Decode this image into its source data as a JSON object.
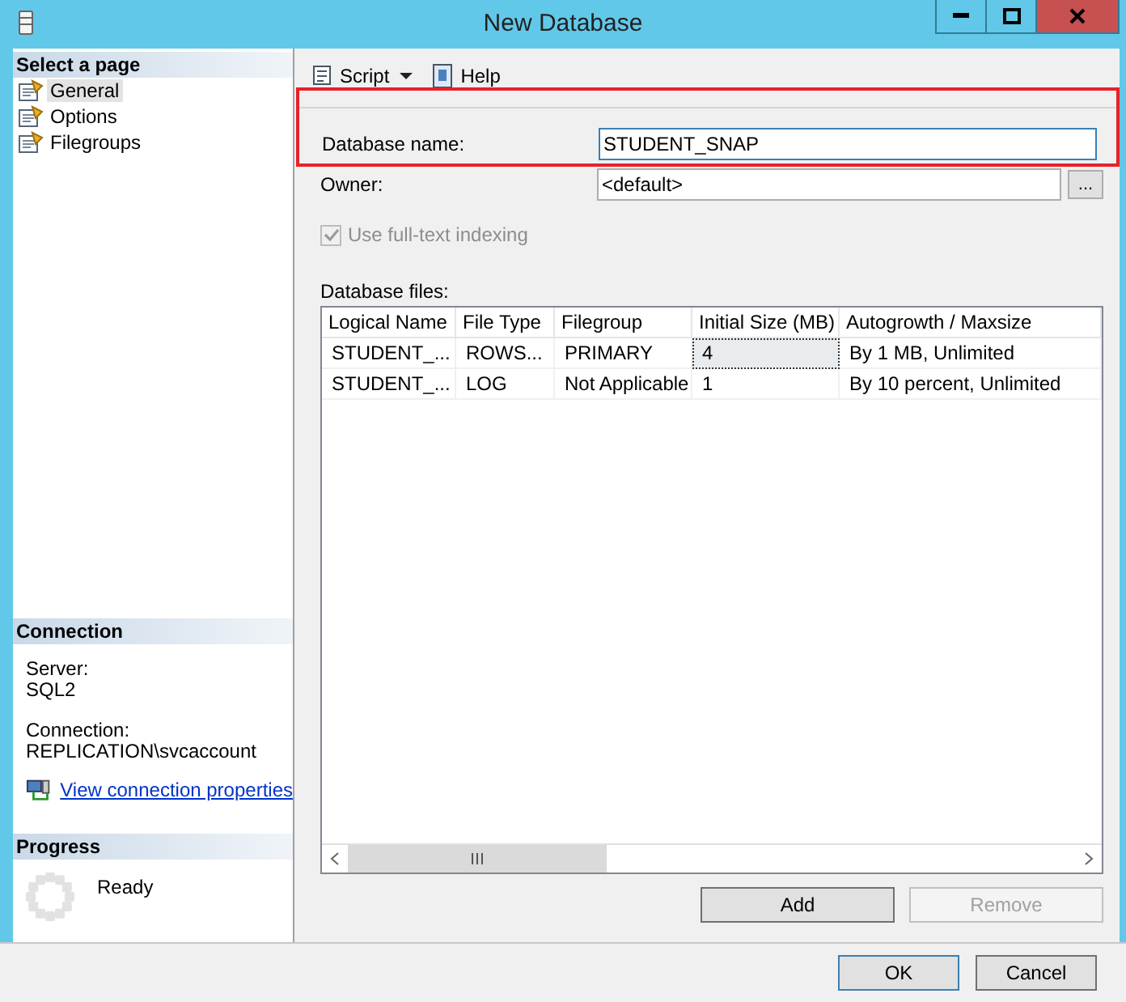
{
  "window": {
    "title": "New Database"
  },
  "sidebar": {
    "header": "Select a page",
    "pages": [
      {
        "label": "General",
        "selected": true
      },
      {
        "label": "Options",
        "selected": false
      },
      {
        "label": "Filegroups",
        "selected": false
      }
    ],
    "connection": {
      "header": "Connection",
      "server_label": "Server:",
      "server": "SQL2",
      "connection_label": "Connection:",
      "connection": "REPLICATION\\svcaccount",
      "link": "View connection properties"
    },
    "progress": {
      "header": "Progress",
      "status": "Ready"
    }
  },
  "toolbar": [
    {
      "kind": "dropdown",
      "label": "Script"
    },
    {
      "kind": "button",
      "label": "Help"
    }
  ],
  "form": {
    "highlighted": true,
    "name_label": "Database name:",
    "name_value": "STUDENT_SNAP",
    "owner_label": "Owner:",
    "owner_value": "<default>",
    "browse_button": "...",
    "fulltext": {
      "label": "Use full-text indexing",
      "checked": true,
      "disabled": true
    }
  },
  "files": {
    "label": "Database files:",
    "columns": [
      "Logical Name",
      "File Type",
      "Filegroup",
      "Initial Size (MB)",
      "Autogrowth / Maxsize"
    ],
    "rows": [
      {
        "cells": [
          {
            "text": "STUDENT_...",
            "focused": false
          },
          {
            "text": "ROWS...",
            "focused": false
          },
          {
            "text": "PRIMARY",
            "focused": false
          },
          {
            "text": "4",
            "focused": true
          },
          {
            "text": "By 1 MB, Unlimited",
            "focused": false
          }
        ]
      },
      {
        "cells": [
          {
            "text": "STUDENT_...",
            "focused": false
          },
          {
            "text": "LOG",
            "focused": false
          },
          {
            "text": "Not Applicable",
            "focused": false
          },
          {
            "text": "1",
            "focused": false
          },
          {
            "text": "By 10 percent, Unlimited",
            "focused": false
          }
        ]
      }
    ]
  },
  "file_buttons": [
    {
      "label": "Add",
      "disabled": false
    },
    {
      "label": "Remove",
      "disabled": true
    }
  ],
  "dialog_buttons": [
    {
      "label": "OK",
      "default": true
    },
    {
      "label": "Cancel",
      "default": false
    }
  ]
}
